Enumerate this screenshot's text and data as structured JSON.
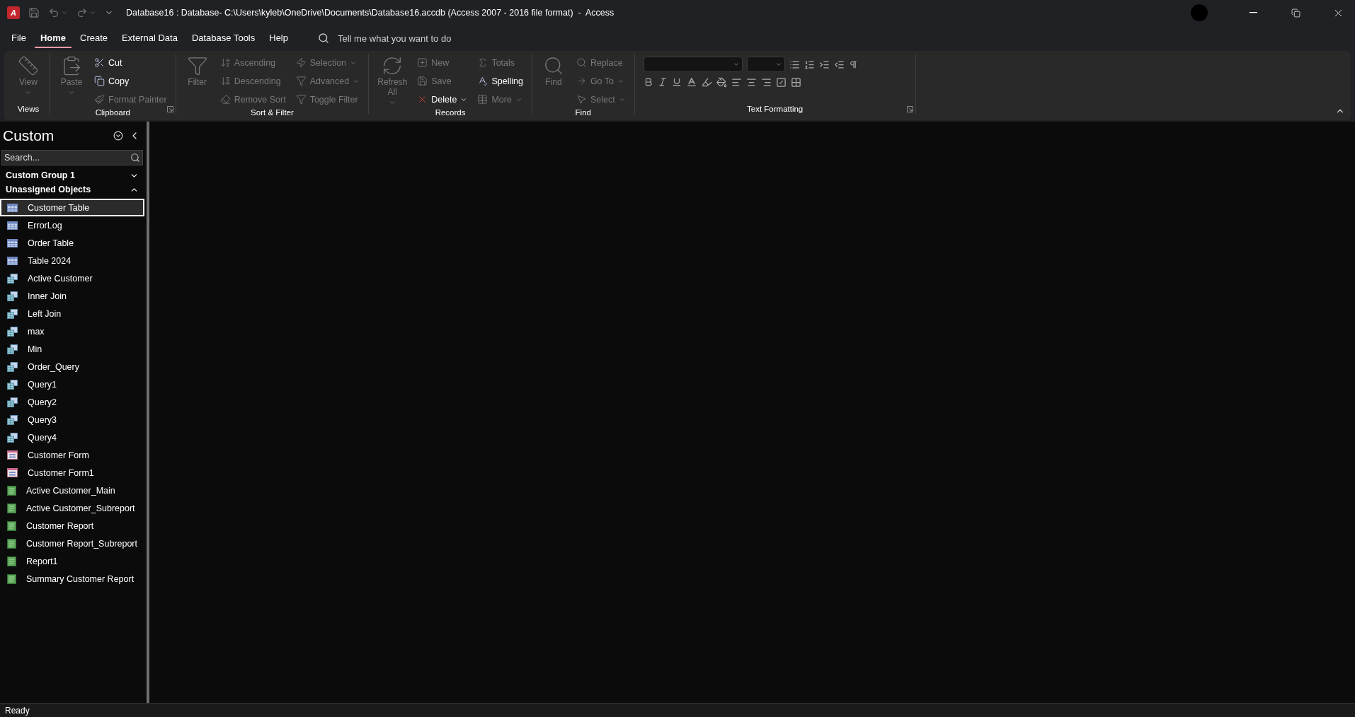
{
  "title_bar": {
    "logo_letter": "A",
    "title": "Database16 : Database- C:\\Users\\kyleb\\OneDrive\\Documents\\Database16.accdb (Access 2007 - 2016 file format)  -  Access"
  },
  "tabs": [
    {
      "label": "File",
      "selected": false
    },
    {
      "label": "Home",
      "selected": true
    },
    {
      "label": "Create",
      "selected": false
    },
    {
      "label": "External Data",
      "selected": false
    },
    {
      "label": "Database Tools",
      "selected": false
    },
    {
      "label": "Help",
      "selected": false
    }
  ],
  "tell_me": {
    "placeholder": "Tell me what you want to do"
  },
  "ribbon": {
    "groups": [
      {
        "label": "Views",
        "columns": [
          {
            "kind": "large",
            "commands": [
              {
                "label": "View",
                "disabled": true,
                "dropdown": true
              }
            ]
          }
        ]
      },
      {
        "label": "Clipboard",
        "launcher": true,
        "columns": [
          {
            "kind": "large",
            "commands": [
              {
                "label": "Paste",
                "disabled": true,
                "dropdown": true
              }
            ]
          },
          {
            "kind": "stack",
            "commands": [
              {
                "label": "Cut",
                "disabled": false
              },
              {
                "label": "Copy",
                "disabled": false
              },
              {
                "label": "Format Painter",
                "disabled": true
              }
            ]
          }
        ]
      },
      {
        "label": "Sort & Filter",
        "columns": [
          {
            "kind": "large",
            "commands": [
              {
                "label": "Filter",
                "disabled": true
              }
            ]
          },
          {
            "kind": "stack",
            "commands": [
              {
                "label": "Ascending",
                "disabled": true
              },
              {
                "label": "Descending",
                "disabled": true
              },
              {
                "label": "Remove Sort",
                "disabled": true
              }
            ]
          },
          {
            "kind": "stack",
            "commands": [
              {
                "label": "Selection",
                "disabled": true,
                "dropdown": true
              },
              {
                "label": "Advanced",
                "disabled": true,
                "dropdown": true
              },
              {
                "label": "Toggle Filter",
                "disabled": true
              }
            ]
          }
        ]
      },
      {
        "label": "Records",
        "columns": [
          {
            "kind": "large",
            "commands": [
              {
                "label": "Refresh All",
                "disabled": true,
                "dropdown": true
              }
            ]
          },
          {
            "kind": "stack",
            "commands": [
              {
                "label": "New",
                "disabled": true
              },
              {
                "label": "Save",
                "disabled": true
              },
              {
                "label": "Delete",
                "disabled": false,
                "dropdown": true
              }
            ]
          },
          {
            "kind": "stack",
            "commands": [
              {
                "label": "Totals",
                "disabled": true
              },
              {
                "label": "Spelling",
                "disabled": false
              },
              {
                "label": "More",
                "disabled": true,
                "dropdown": true
              }
            ]
          }
        ]
      },
      {
        "label": "Find",
        "columns": [
          {
            "kind": "large",
            "commands": [
              {
                "label": "Find",
                "disabled": true
              }
            ]
          },
          {
            "kind": "stack",
            "commands": [
              {
                "label": "Replace",
                "disabled": true
              },
              {
                "label": "Go To",
                "disabled": true,
                "dropdown": true
              },
              {
                "label": "Select",
                "disabled": true,
                "dropdown": true
              }
            ]
          }
        ]
      },
      {
        "label": "Text Formatting",
        "launcher": true,
        "columns": [
          {
            "kind": "formatting"
          }
        ]
      }
    ]
  },
  "nav_pane": {
    "title": "Custom",
    "search": {
      "placeholder": "Search..."
    },
    "groups": [
      {
        "label": "Custom Group 1",
        "expanded": false
      },
      {
        "label": "Unassigned Objects",
        "expanded": true,
        "items": [
          {
            "label": "Customer Table",
            "kind": "table",
            "selected": true
          },
          {
            "label": "ErrorLog",
            "kind": "table",
            "selected": false
          },
          {
            "label": "Order Table",
            "kind": "table",
            "selected": false
          },
          {
            "label": "Table 2024",
            "kind": "table",
            "selected": false
          },
          {
            "label": "Active Customer",
            "kind": "query",
            "selected": false
          },
          {
            "label": "Inner Join",
            "kind": "query",
            "selected": false
          },
          {
            "label": "Left Join",
            "kind": "query",
            "selected": false
          },
          {
            "label": "max",
            "kind": "query",
            "selected": false
          },
          {
            "label": "Min",
            "kind": "query",
            "selected": false
          },
          {
            "label": "Order_Query",
            "kind": "query",
            "selected": false
          },
          {
            "label": "Query1",
            "kind": "query",
            "selected": false
          },
          {
            "label": "Query2",
            "kind": "query",
            "selected": false
          },
          {
            "label": "Query3",
            "kind": "query",
            "selected": false
          },
          {
            "label": "Query4",
            "kind": "query",
            "selected": false
          },
          {
            "label": "Customer Form",
            "kind": "form",
            "selected": false
          },
          {
            "label": "Customer Form1",
            "kind": "form",
            "selected": false
          },
          {
            "label": "Active Customer_Main",
            "kind": "report",
            "selected": false
          },
          {
            "label": "Active Customer_Subreport",
            "kind": "report",
            "selected": false
          },
          {
            "label": "Customer Report",
            "kind": "report",
            "selected": false
          },
          {
            "label": "Customer Report_Subreport",
            "kind": "report",
            "selected": false
          },
          {
            "label": "Report1",
            "kind": "report",
            "selected": false
          },
          {
            "label": "Summary Customer Report",
            "kind": "report",
            "selected": false
          }
        ]
      }
    ]
  },
  "status_bar": {
    "text": "Ready"
  }
}
